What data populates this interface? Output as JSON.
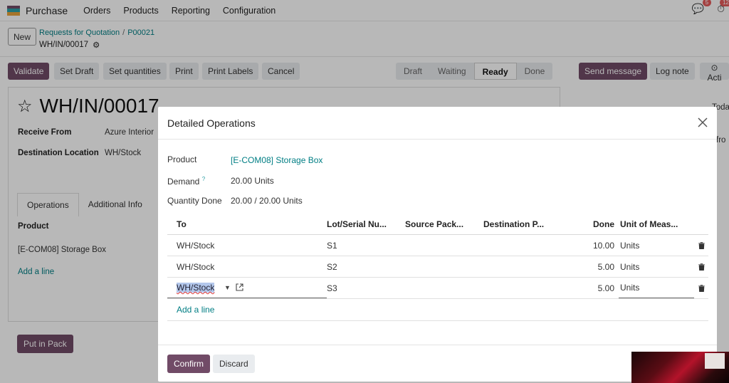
{
  "topbar": {
    "app_name": "Purchase",
    "menu": [
      "Orders",
      "Products",
      "Reporting",
      "Configuration"
    ],
    "messages_count": "5",
    "activities_count": "12",
    "logo_colors": [
      "#714b67",
      "#2ba1a8",
      "#e8a23b"
    ]
  },
  "breadcrumb": {
    "new_label": "New",
    "parent": "Requests for Quotation",
    "order": "P00021",
    "current": "WH/IN/00017"
  },
  "actions": {
    "validate": "Validate",
    "set_draft": "Set Draft",
    "set_quantities": "Set quantities",
    "print": "Print",
    "print_labels": "Print Labels",
    "cancel": "Cancel",
    "send_message": "Send message",
    "log_note": "Log note",
    "activities": "Acti"
  },
  "statusbar": {
    "draft": "Draft",
    "waiting": "Waiting",
    "ready": "Ready",
    "done": "Done"
  },
  "form": {
    "title": "WH/IN/00017",
    "receive_from_label": "Receive From",
    "receive_from_value": "Azure Interior",
    "dest_label": "Destination Location",
    "dest_value": "WH/Stock",
    "tabs": [
      "Operations",
      "Additional Info"
    ],
    "col_product": "Product",
    "line_product": "[E-COM08] Storage Box",
    "add_line": "Add a line",
    "put_in_pack": "Put in Pack",
    "right_peek_1": "Toda",
    "right_peek_2": "fro"
  },
  "modal": {
    "title": "Detailed Operations",
    "product_label": "Product",
    "product_value": "[E-COM08] Storage Box",
    "demand_label": "Demand",
    "demand_help": "?",
    "demand_value": "20.00 Units",
    "qty_done_label": "Quantity Done",
    "qty_done_value": "20.00 / 20.00 Units",
    "columns": {
      "to": "To",
      "lot": "Lot/Serial Nu...",
      "source": "Source Pack...",
      "destination": "Destination P...",
      "done": "Done",
      "uom": "Unit of Meas..."
    },
    "rows": [
      {
        "to": "WH/Stock",
        "lot": "S1",
        "done": "10.00",
        "uom": "Units"
      },
      {
        "to": "WH/Stock",
        "lot": "S2",
        "done": "5.00",
        "uom": "Units"
      },
      {
        "to": "WH/Stock",
        "lot": "S3",
        "done": "5.00",
        "uom": "Units"
      }
    ],
    "add_line": "Add a line",
    "confirm": "Confirm",
    "discard": "Discard"
  }
}
